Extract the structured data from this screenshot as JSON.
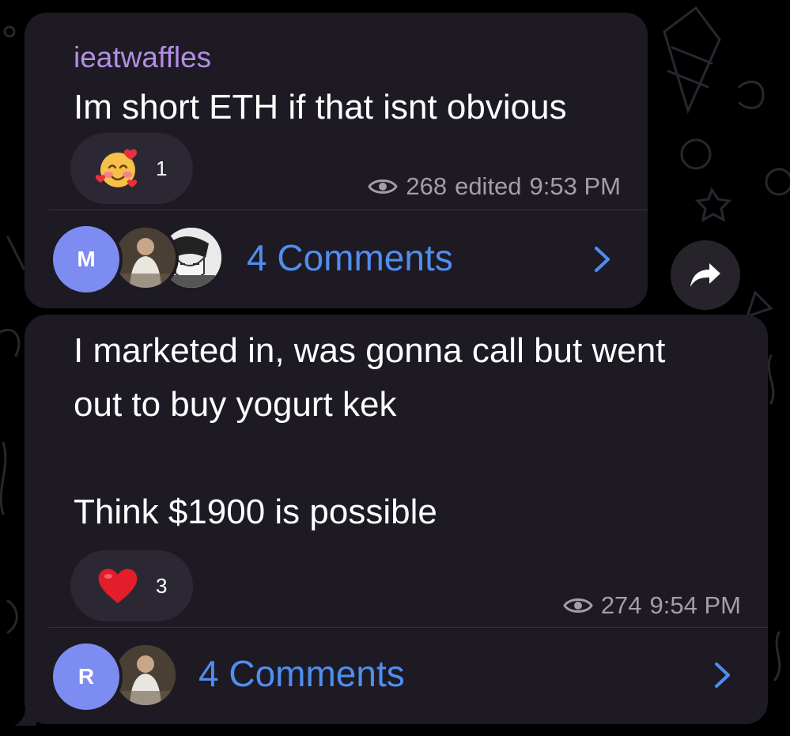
{
  "colors": {
    "bubble": "#1d1a23",
    "accent_blue": "#4f8ef0",
    "sender_purple": "#b48ee6",
    "meta_grey": "#a29eaa",
    "avatar_blue": "#7d8cf1"
  },
  "messages": [
    {
      "sender": "ieatwaffles",
      "text": "Im short ETH if that isnt obvious",
      "reaction": {
        "emoji_icon": "smiling-face-with-hearts-emoji",
        "count": "1"
      },
      "views": "268",
      "edited_label": "edited",
      "time": "9:53 PM",
      "comments": {
        "avatar_letter": "M",
        "label": "4 Comments"
      }
    },
    {
      "text": "I marketed in, was gonna call but went\nout to buy yogurt kek\n\nThink $1900 is possible",
      "reaction": {
        "emoji_icon": "red-heart-emoji",
        "count": "3"
      },
      "views": "274",
      "time": "9:54 PM",
      "comments": {
        "avatar_letter": "R",
        "label": "4 Comments"
      }
    }
  ]
}
